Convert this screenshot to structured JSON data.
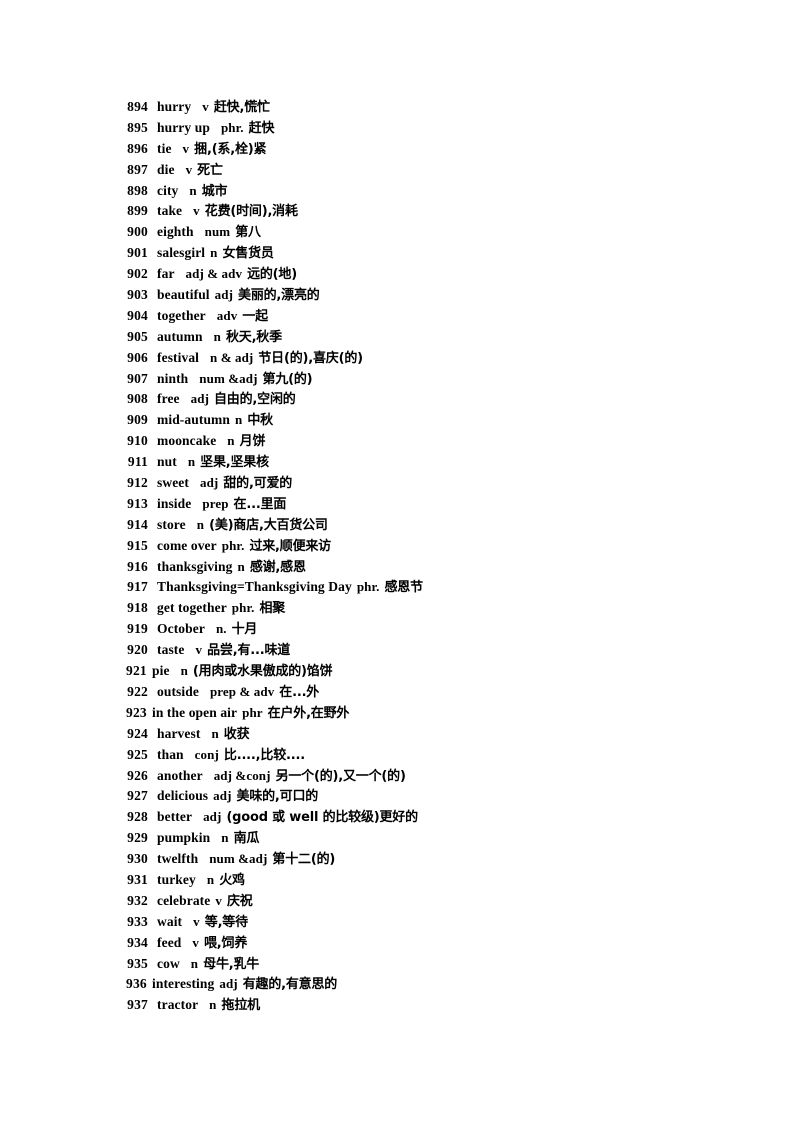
{
  "document": {
    "type": "vocabulary-word-list",
    "page_background": "#ffffff",
    "text_color": "#000000"
  },
  "entries": [
    {
      "num": "894",
      "word": "hurry",
      "pos": "v",
      "gloss": "赶快,慌忙",
      "layout": "normal"
    },
    {
      "num": "895",
      "word": "hurry up",
      "pos": "phr.",
      "gloss": "赶快",
      "layout": "normal"
    },
    {
      "num": "896",
      "word": "tie",
      "pos": "v",
      "gloss": "捆,(系,栓)紧",
      "layout": "normal"
    },
    {
      "num": "897",
      "word": "die",
      "pos": "v",
      "gloss": "死亡",
      "layout": "normal"
    },
    {
      "num": "898",
      "word": "city",
      "pos": "n",
      "gloss": "城市",
      "layout": "normal"
    },
    {
      "num": "899",
      "word": "take",
      "pos": "v",
      "gloss": "花费(时间),消耗",
      "layout": "normal"
    },
    {
      "num": "900",
      "word": "eighth",
      "pos": "num",
      "gloss": "第八",
      "layout": "normal"
    },
    {
      "num": "901",
      "word": "salesgirl",
      "pos": "n",
      "gloss": "女售货员",
      "layout": "normal"
    },
    {
      "num": "902",
      "word": "far",
      "pos": "adj & adv",
      "gloss": "远的(地)",
      "layout": "normal"
    },
    {
      "num": "903",
      "word": "beautiful",
      "pos": "adj",
      "gloss": "美丽的,漂亮的",
      "layout": "normal"
    },
    {
      "num": "904",
      "word": "together",
      "pos": "adv",
      "gloss": "一起",
      "layout": "normal"
    },
    {
      "num": "905",
      "word": "autumn",
      "pos": "n",
      "gloss": "秋天,秋季",
      "layout": "normal"
    },
    {
      "num": "906",
      "word": "festival",
      "pos": "n & adj",
      "gloss": "节日(的),喜庆(的)",
      "layout": "normal"
    },
    {
      "num": "907",
      "word": "ninth",
      "pos": "num &adj",
      "gloss": "第九(的)",
      "layout": "normal"
    },
    {
      "num": "908",
      "word": "free",
      "pos": "adj",
      "gloss": "自由的,空闲的",
      "layout": "normal"
    },
    {
      "num": "909",
      "word": "mid-autumn",
      "pos": "n",
      "gloss": "中秋",
      "layout": "normal"
    },
    {
      "num": "910",
      "word": "mooncake",
      "pos": "n",
      "gloss": "月饼",
      "layout": "normal"
    },
    {
      "num": "911",
      "word": "nut",
      "pos": "n",
      "gloss": "坚果,坚果核",
      "layout": "normal"
    },
    {
      "num": "912",
      "word": "sweet",
      "pos": "adj",
      "gloss": "甜的,可爱的",
      "layout": "normal"
    },
    {
      "num": "913",
      "word": "inside",
      "pos": "prep",
      "gloss": "在...里面",
      "layout": "normal"
    },
    {
      "num": "914",
      "word": "store",
      "pos": "n",
      "gloss": "(美)商店,大百货公司",
      "layout": "normal"
    },
    {
      "num": "915",
      "word": "come over",
      "pos": "phr.",
      "gloss": "过来,顺便来访",
      "layout": "normal"
    },
    {
      "num": "916",
      "word": "thanksgiving",
      "pos": "n",
      "gloss": "感谢,感恩",
      "layout": "normal"
    },
    {
      "num": "917",
      "word": "Thanksgiving=Thanksgiving Day",
      "pos": "phr.",
      "gloss": "感恩节",
      "layout": "normal"
    },
    {
      "num": "918",
      "word": "get together",
      "pos": "phr.",
      "gloss": "相聚",
      "layout": "normal"
    },
    {
      "num": "919",
      "word": "October",
      "pos": "n.",
      "gloss": "十月",
      "layout": "normal"
    },
    {
      "num": "920",
      "word": "taste",
      "pos": "v",
      "gloss": "品尝,有...味道",
      "layout": "normal"
    },
    {
      "num": "921",
      "word": "pie",
      "pos": "n",
      "gloss": "(用肉或水果傲成的)馅饼",
      "layout": "wide"
    },
    {
      "num": "922",
      "word": "outside",
      "pos": "prep & adv",
      "gloss": "在...外",
      "layout": "normal"
    },
    {
      "num": "923",
      "word": "in the open air",
      "pos": "phr",
      "gloss": "在户外,在野外",
      "layout": "wide"
    },
    {
      "num": "924",
      "word": "harvest",
      "pos": "n",
      "gloss": "收获",
      "layout": "normal"
    },
    {
      "num": "925",
      "word": "than",
      "pos": "conj",
      "gloss": "比....,比较....",
      "layout": "normal"
    },
    {
      "num": "926",
      "word": "another",
      "pos": "adj &conj",
      "gloss": "另一个(的),又一个(的)",
      "layout": "normal"
    },
    {
      "num": "927",
      "word": "delicious",
      "pos": "adj",
      "gloss": "美味的,可口的",
      "layout": "normal"
    },
    {
      "num": "928",
      "word": "better",
      "pos": "adj",
      "gloss": "(good 或 well 的比较级)更好的",
      "layout": "normal"
    },
    {
      "num": "929",
      "word": "pumpkin",
      "pos": "n",
      "gloss": "南瓜",
      "layout": "normal"
    },
    {
      "num": "930",
      "word": "twelfth",
      "pos": "num &adj",
      "gloss": "第十二(的)",
      "layout": "normal"
    },
    {
      "num": "931",
      "word": "turkey",
      "pos": "n",
      "gloss": "火鸡",
      "layout": "normal"
    },
    {
      "num": "932",
      "word": "celebrate",
      "pos": "v",
      "gloss": "庆祝",
      "layout": "normal"
    },
    {
      "num": "933",
      "word": "wait",
      "pos": "v",
      "gloss": "等,等待",
      "layout": "normal"
    },
    {
      "num": "934",
      "word": "feed",
      "pos": "v",
      "gloss": "喂,饲养",
      "layout": "normal"
    },
    {
      "num": "935",
      "word": "cow",
      "pos": "n",
      "gloss": "母牛,乳牛",
      "layout": "normal"
    },
    {
      "num": "936",
      "word": "interesting",
      "pos": "adj",
      "gloss": "有趣的,有意思的",
      "layout": "wide"
    },
    {
      "num": "937",
      "word": "tractor",
      "pos": "n",
      "gloss": "拖拉机",
      "layout": "normal"
    }
  ]
}
